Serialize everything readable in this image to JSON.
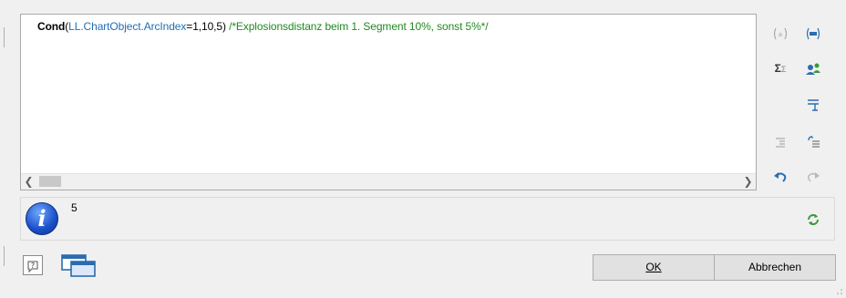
{
  "editor": {
    "formula": {
      "func": "Cond",
      "open_paren": "(",
      "field": "LL.ChartObject.ArcIndex",
      "args": "=1,10,5)",
      "comment": "/*Explosionsdistanz beim 1. Segment 10%, sonst 5%*/"
    }
  },
  "toolbar": {
    "sum_label": "Σ"
  },
  "info": {
    "result": "5"
  },
  "footer": {
    "ok_label": "OK",
    "cancel_label": "Abbrechen",
    "help_label": "?"
  },
  "colors": {
    "accent": "#2b6cb0",
    "field": "#1f6fb5",
    "comment": "#1f8a1f",
    "refresh": "#3a9a3a"
  }
}
